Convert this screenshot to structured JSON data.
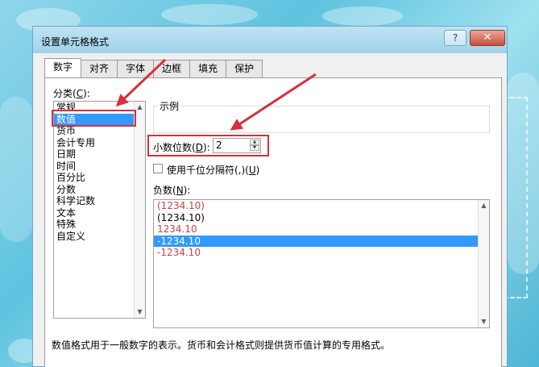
{
  "window": {
    "title": "设置单元格格式",
    "help_label": "?",
    "close_label": "✕"
  },
  "tabs": [
    {
      "label": "数字",
      "active": true
    },
    {
      "label": "对齐",
      "active": false
    },
    {
      "label": "字体",
      "active": false
    },
    {
      "label": "边框",
      "active": false
    },
    {
      "label": "填充",
      "active": false
    },
    {
      "label": "保护",
      "active": false
    }
  ],
  "category": {
    "label": "分类(",
    "key": "C",
    "label_end": "):",
    "items": [
      "常规",
      "数值",
      "货币",
      "会计专用",
      "日期",
      "时间",
      "百分比",
      "分数",
      "科学记数",
      "文本",
      "特殊",
      "自定义"
    ],
    "selected_index": 1
  },
  "sample": {
    "label": "示例"
  },
  "decimal": {
    "label": "小数位数(",
    "key": "D",
    "label_end": "):",
    "value": "2"
  },
  "thousands": {
    "label": "使用千位分隔符(,)(",
    "key": "U",
    "label_end": ")",
    "checked": false
  },
  "negative": {
    "label": "负数(",
    "key": "N",
    "label_end": "):",
    "items": [
      {
        "text": "(1234.10)",
        "color": "#d04040"
      },
      {
        "text": "(1234.10)",
        "color": "#000000"
      },
      {
        "text": "1234.10",
        "color": "#d04040"
      },
      {
        "text": "-1234.10",
        "color": "#000000"
      },
      {
        "text": "-1234.10",
        "color": "#d04040"
      }
    ],
    "selected_index": 3
  },
  "description": "数值格式用于一般数字的表示。货币和会计格式则提供货币值计算的专用格式。",
  "colors": {
    "selection": "#3399ff",
    "annotation_red": "#d9303a",
    "negative_red": "#d04040"
  }
}
